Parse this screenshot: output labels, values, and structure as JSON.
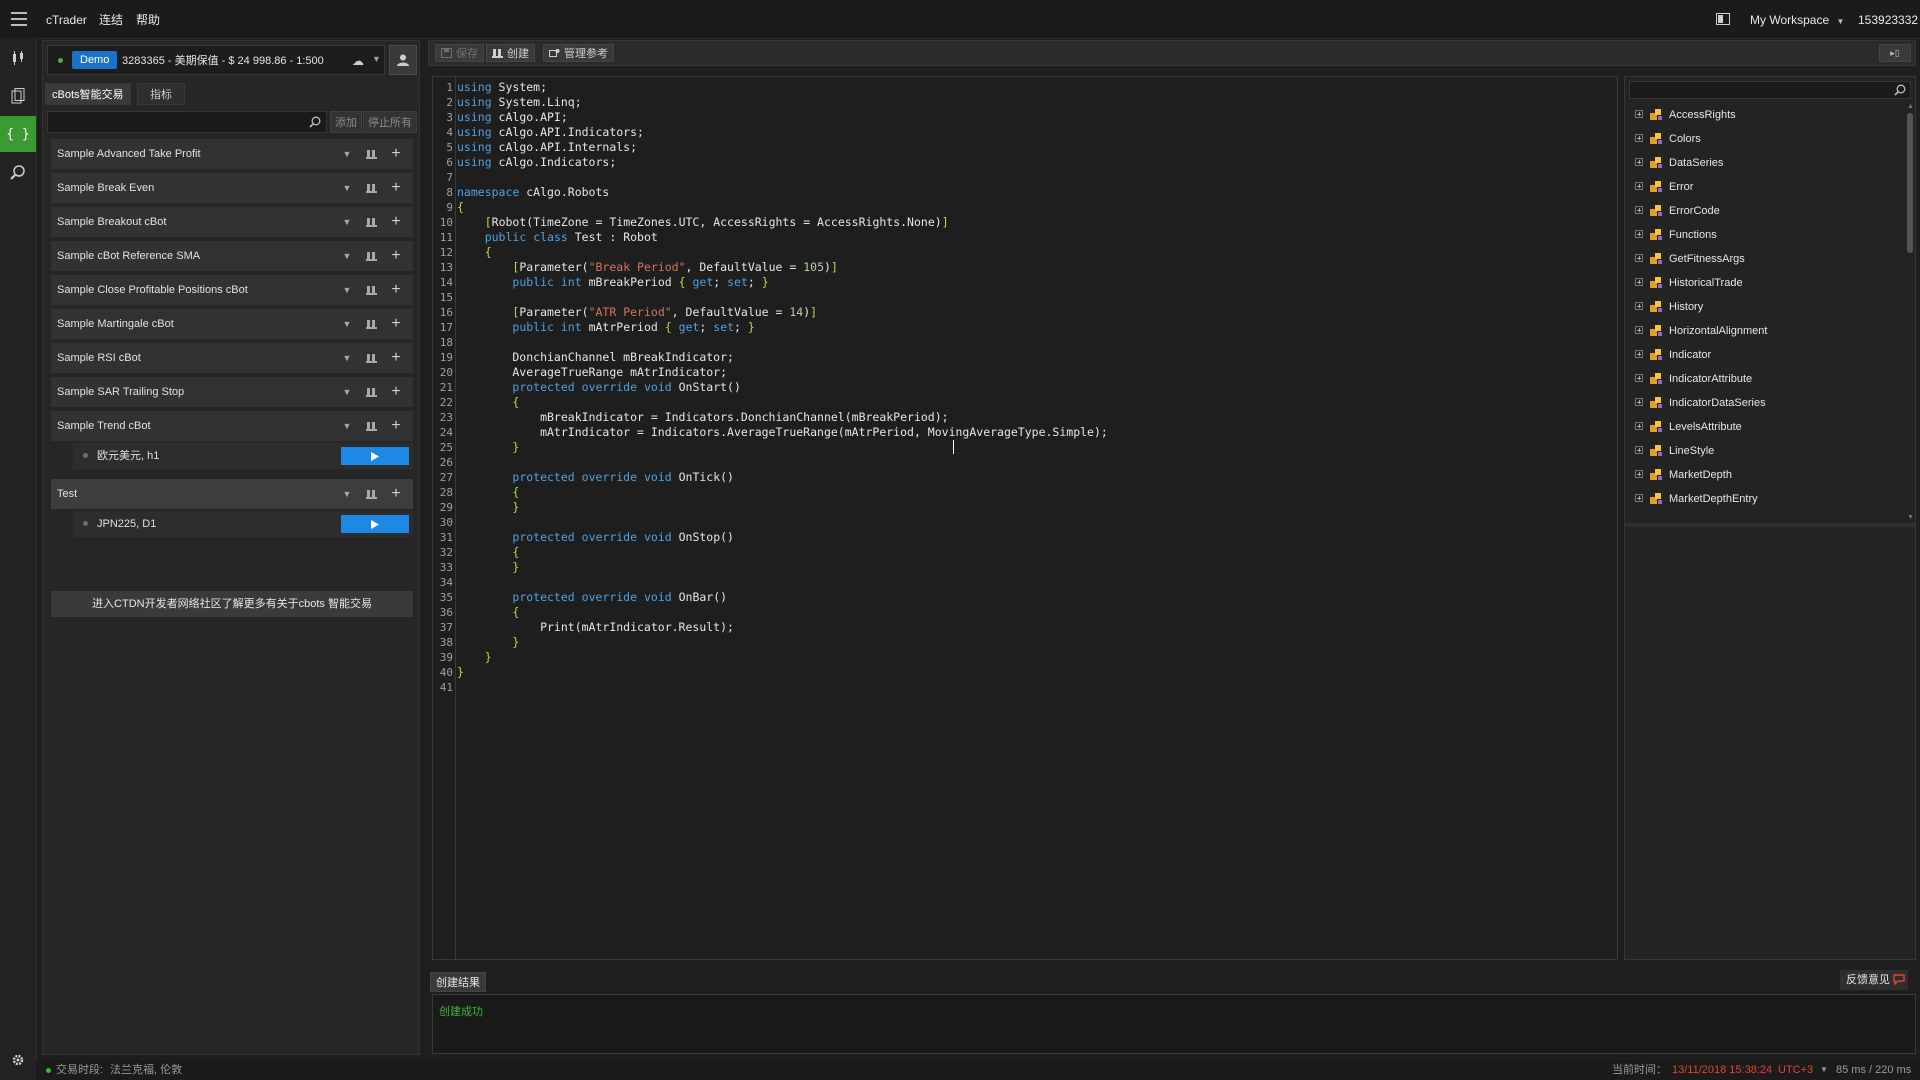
{
  "topbar": {
    "app_name": "cTrader",
    "menu": [
      "连结",
      "帮助"
    ],
    "workspace": "My Workspace",
    "account_id": "153923332"
  },
  "account": {
    "mode": "Demo",
    "info": "3283365 - 美期保值 - $ 24 998.86 - 1:500"
  },
  "panel_tabs": [
    "cBots智能交易",
    "指标"
  ],
  "panel_buttons": {
    "add": "添加",
    "stop_all": "停止所有"
  },
  "bots": [
    {
      "name": "Sample Advanced Take Profit"
    },
    {
      "name": "Sample Break Even"
    },
    {
      "name": "Sample Breakout cBot"
    },
    {
      "name": "Sample cBot Reference SMA"
    },
    {
      "name": "Sample Close Profitable Positions cBot"
    },
    {
      "name": "Sample Martingale cBot"
    },
    {
      "name": "Sample RSI cBot"
    },
    {
      "name": "Sample SAR Trailing Stop"
    },
    {
      "name": "Sample Trend cBot",
      "instance": "欧元美元, h1"
    },
    {
      "name": "Test",
      "instance": "JPN225, D1",
      "active": true
    }
  ],
  "ctdn_link": "进入CTDN开发者网络社区了解更多有关于cbots 智能交易",
  "toolbar": {
    "save": "保存",
    "build": "创建",
    "manage_refs": "管理参考"
  },
  "code": {
    "caret_line": 25,
    "lines": [
      "using System;",
      "using System.Linq;",
      "using cAlgo.API;",
      "using cAlgo.API.Indicators;",
      "using cAlgo.API.Internals;",
      "using cAlgo.Indicators;",
      "",
      "namespace cAlgo.Robots",
      "{",
      "    [Robot(TimeZone = TimeZones.UTC, AccessRights = AccessRights.None)]",
      "    public class Test : Robot",
      "    {",
      "        [Parameter(\"Break Period\", DefaultValue = 105)]",
      "        public int mBreakPeriod { get; set; }",
      "",
      "        [Parameter(\"ATR Period\", DefaultValue = 14)]",
      "        public int mAtrPeriod { get; set; }",
      "",
      "        DonchianChannel mBreakIndicator;",
      "        AverageTrueRange mAtrIndicator;",
      "        protected override void OnStart()",
      "        {",
      "            mBreakIndicator = Indicators.DonchianChannel(mBreakPeriod);",
      "            mAtrIndicator = Indicators.AverageTrueRange(mAtrPeriod, MovingAverageType.Simple);",
      "        }",
      "",
      "        protected override void OnTick()",
      "        {",
      "        }",
      "",
      "        protected override void OnStop()",
      "        {",
      "        }",
      "",
      "        protected override void OnBar()",
      "        {",
      "            Print(mAtrIndicator.Result);",
      "        }",
      "    }",
      "}",
      ""
    ]
  },
  "object_browser": {
    "items": [
      "AccessRights",
      "Colors",
      "DataSeries",
      "Error",
      "ErrorCode",
      "Functions",
      "GetFitnessArgs",
      "HistoricalTrade",
      "History",
      "HorizontalAlignment",
      "Indicator",
      "IndicatorAttribute",
      "IndicatorDataSeries",
      "LevelsAttribute",
      "LineStyle",
      "MarketDepth",
      "MarketDepthEntry"
    ]
  },
  "output": {
    "tab": "创建结果",
    "message": "创建成功",
    "feedback": "反馈意见"
  },
  "status": {
    "session_label": "交易时段:",
    "session_value": "法兰克福, 伦敦",
    "time_label": "当前时间：",
    "time_value": "13/11/2018 15:38:24",
    "timezone": "UTC+3",
    "latency": "85 ms / 220 ms"
  },
  "colors": {
    "accent_green": "#3c9a35",
    "demo_blue": "#1a73c9",
    "play_blue": "#1e88e5",
    "status_red": "#e0432e",
    "keyword": "#4fa0e0",
    "string": "#d6735f"
  }
}
